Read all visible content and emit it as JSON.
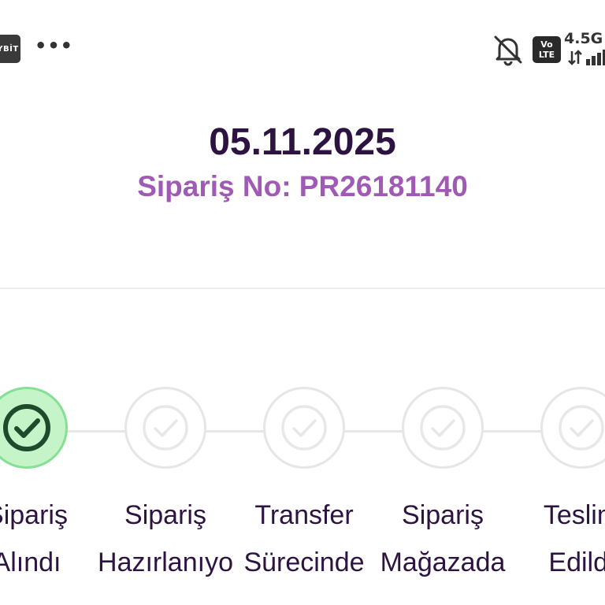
{
  "status_bar": {
    "app_badge_text": "YBİT",
    "more_icon": "more-dots-icon",
    "notification_icon": "bell-off-icon",
    "volte_line1": "Vo",
    "volte_line2": "LTE",
    "network_type": "4.5G"
  },
  "order": {
    "date": "05.11.2025",
    "order_number_text": "Sipariş No: PR26181140"
  },
  "steps": [
    {
      "line1": "Sipariş",
      "line2": "Alındı",
      "completed": true
    },
    {
      "line1": "Sipariş",
      "line2": "Hazırlanıyo",
      "completed": false
    },
    {
      "line1": "Transfer",
      "line2": "Sürecinde",
      "completed": false
    },
    {
      "line1": "Sipariş",
      "line2": "Mağazada",
      "completed": false
    },
    {
      "line1": "Teslim",
      "line2": "Edildi",
      "completed": false
    }
  ],
  "colors": {
    "title": "#2d1342",
    "accent": "#a05ab6",
    "active_fill": "#c4f4c8",
    "active_border": "#86e094",
    "active_check": "#1f4a2c",
    "inactive_border": "#e6e6e6",
    "inactive_check": "#e8e8e8"
  }
}
